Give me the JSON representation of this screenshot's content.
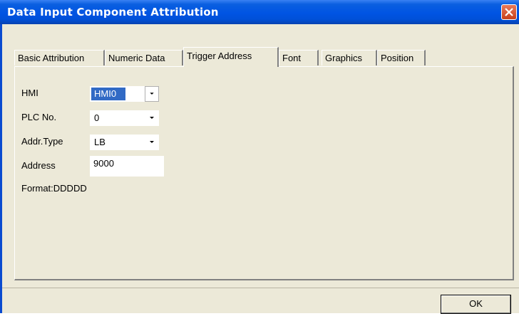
{
  "window": {
    "title": "Data Input Component Attribution"
  },
  "tabs": [
    {
      "label": "Basic Attribution",
      "active": false
    },
    {
      "label": "Numeric Data",
      "active": false
    },
    {
      "label": "Trigger Address",
      "active": true
    },
    {
      "label": "Font",
      "active": false
    },
    {
      "label": "Graphics",
      "active": false
    },
    {
      "label": "Position",
      "active": false
    }
  ],
  "form": {
    "hmi": {
      "label": "HMI",
      "value": "HMI0"
    },
    "plc_no": {
      "label": "PLC No.",
      "value": "0"
    },
    "addr_type": {
      "label": "Addr.Type",
      "value": "LB"
    },
    "address": {
      "label": "Address",
      "value": "9000"
    },
    "format": "Format:DDDDD"
  },
  "buttons": {
    "ok": "OK"
  },
  "icons": {
    "close": "close-icon",
    "dropdown": "chevron-down-icon"
  },
  "colors": {
    "titlebar": "#0054e3",
    "selection": "#316ac5",
    "dialog_bg": "#ece9d8",
    "close": "#c8401b"
  }
}
